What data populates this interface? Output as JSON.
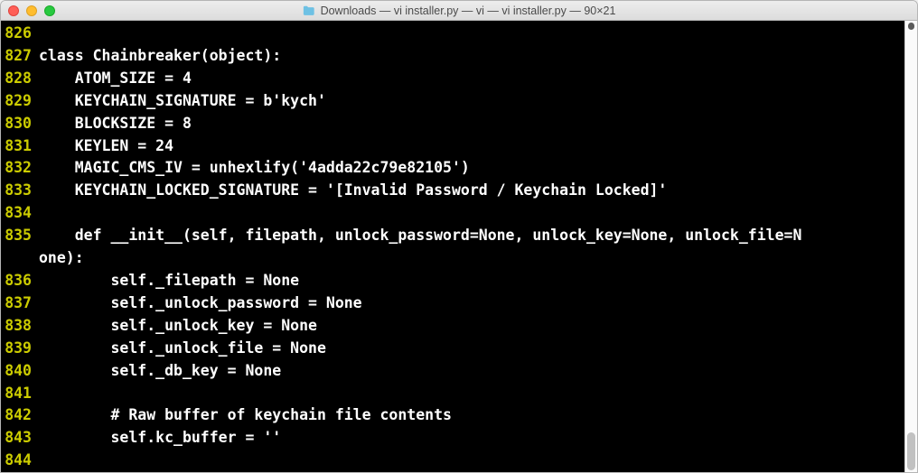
{
  "title": "Downloads — vi installer.py — vi — vi installer.py — 90×21",
  "lines": [
    {
      "n": "826",
      "t": ""
    },
    {
      "n": "827",
      "t": "class Chainbreaker(object):"
    },
    {
      "n": "828",
      "t": "    ATOM_SIZE = 4"
    },
    {
      "n": "829",
      "t": "    KEYCHAIN_SIGNATURE = b'kych'"
    },
    {
      "n": "830",
      "t": "    BLOCKSIZE = 8"
    },
    {
      "n": "831",
      "t": "    KEYLEN = 24"
    },
    {
      "n": "832",
      "t": "    MAGIC_CMS_IV = unhexlify('4adda22c79e82105')"
    },
    {
      "n": "833",
      "t": "    KEYCHAIN_LOCKED_SIGNATURE = '[Invalid Password / Keychain Locked]'"
    },
    {
      "n": "834",
      "t": ""
    },
    {
      "n": "835",
      "t": "    def __init__(self, filepath, unlock_password=None, unlock_key=None, unlock_file=N"
    },
    {
      "n": "",
      "t": "one):",
      "wrap": true
    },
    {
      "n": "836",
      "t": "        self._filepath = None"
    },
    {
      "n": "837",
      "t": "        self._unlock_password = None"
    },
    {
      "n": "838",
      "t": "        self._unlock_key = None"
    },
    {
      "n": "839",
      "t": "        self._unlock_file = None"
    },
    {
      "n": "840",
      "t": "        self._db_key = None"
    },
    {
      "n": "841",
      "t": ""
    },
    {
      "n": "842",
      "t": "        # Raw buffer of keychain file contents"
    },
    {
      "n": "843",
      "t": "        self.kc_buffer = ''"
    },
    {
      "n": "844",
      "t": ""
    }
  ]
}
